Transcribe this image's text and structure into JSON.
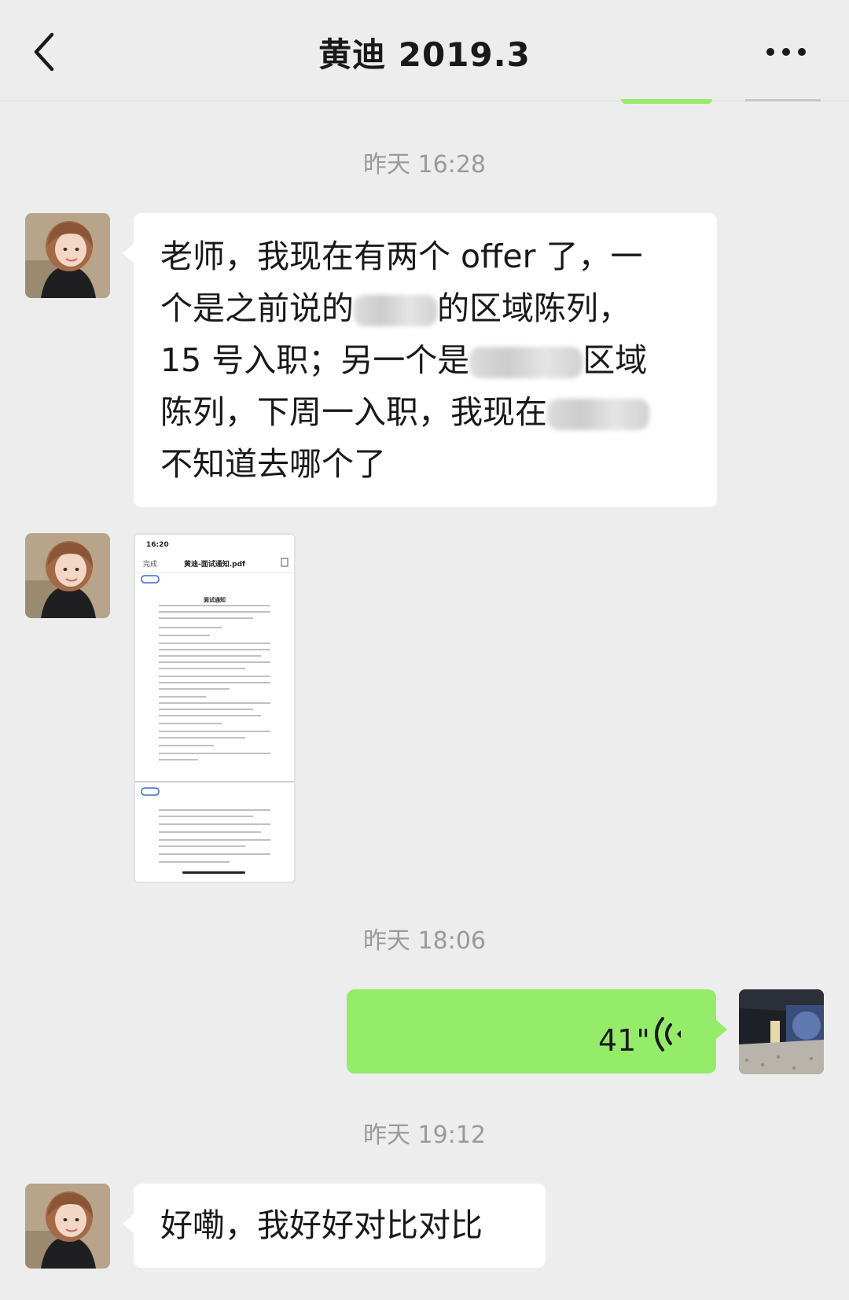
{
  "header": {
    "title": "黄迪 2019.3",
    "back_icon": "chevron-left-icon",
    "more_icon": "more-dots-icon"
  },
  "messages": [
    {
      "type": "time",
      "text": "昨天 16:28"
    },
    {
      "type": "text",
      "side": "left",
      "line1": "老师，我现在有两个 offer 了，一",
      "line2a": "个是之前说的",
      "line2b": "的区域陈列，",
      "line3a": "15 号入职；另一个是",
      "line3b": "区域",
      "line4": "陈列，下周一入职，我现在",
      "line5": "不知道去哪个了"
    },
    {
      "type": "file",
      "side": "left",
      "thumb": {
        "time": "16:20",
        "done": "完成",
        "filename": "黄迪-面试通知.pdf",
        "doc_heading": "面试通知"
      }
    },
    {
      "type": "time",
      "text": "昨天 18:06"
    },
    {
      "type": "voice",
      "side": "right",
      "duration": "41\"",
      "icon": "voice-wave-icon"
    },
    {
      "type": "time",
      "text": "昨天 19:12"
    },
    {
      "type": "text",
      "side": "left",
      "text": "好嘞，我好好对比对比"
    }
  ],
  "colors": {
    "background": "#ededed",
    "bubble_self": "#95ec69",
    "bubble_other": "#ffffff",
    "timestamp": "#9a9a9a"
  }
}
